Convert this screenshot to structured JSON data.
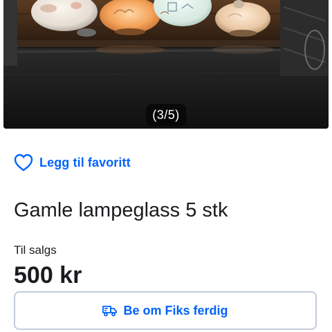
{
  "gallery": {
    "counter": "(3/5)",
    "image_icon": "lamp-glass-photo"
  },
  "favorite": {
    "label": "Legg til favoritt",
    "icon": "heart-outline-icon"
  },
  "listing": {
    "title": "Gamle lampeglass 5 stk",
    "status": "Til salgs",
    "price": "500 kr"
  },
  "cta": {
    "label": "Be om Fiks ferdig",
    "icon": "delivery-truck-icon"
  },
  "colors": {
    "accent": "#0063fb",
    "text": "#1b1b1f",
    "button_border": "#c3ccd9"
  }
}
